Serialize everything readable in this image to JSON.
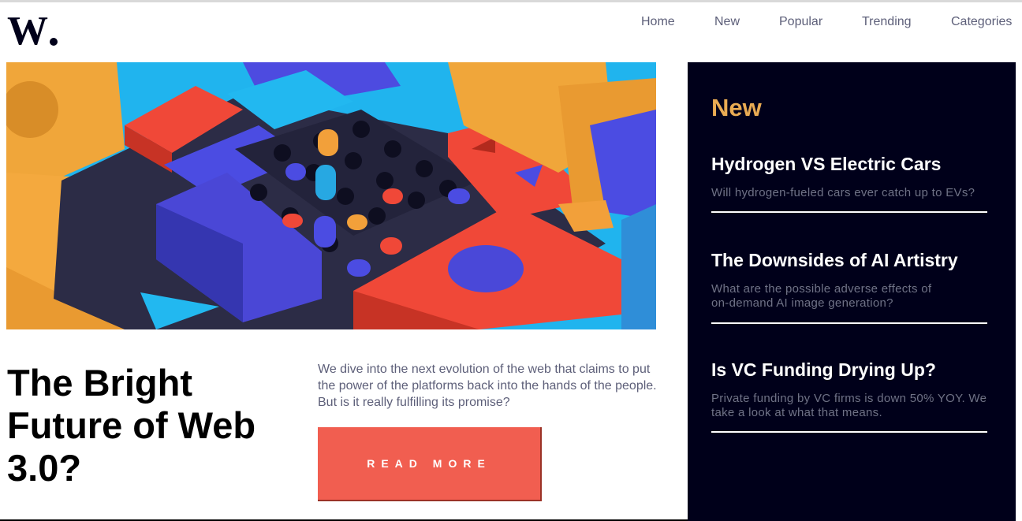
{
  "brand": {
    "logo_text": "W."
  },
  "nav": {
    "items": [
      {
        "label": "Home"
      },
      {
        "label": "New"
      },
      {
        "label": "Popular"
      },
      {
        "label": "Trending"
      },
      {
        "label": "Categories"
      }
    ]
  },
  "hero": {
    "title": "The Bright Future of Web 3.0?",
    "description": "We dive into the next evolution of the web that claims to put the power of the platforms back into the hands of the people. But is it really fulfilling its promise?",
    "cta_label": "READ MORE"
  },
  "sidebar": {
    "heading": "New",
    "articles": [
      {
        "title": "Hydrogen VS Electric Cars",
        "summary": "Will hydrogen-fueled cars ever catch up to EVs?"
      },
      {
        "title": "The Downsides of AI Artistry",
        "summary": "What are the possible adverse effects of on-demand AI image generation?"
      },
      {
        "title": "Is VC Funding Drying Up?",
        "summary": "Private funding by VC firms is down 50% YOY. We take a look at what that means."
      }
    ]
  },
  "colors": {
    "accent": "#f15e50",
    "sidebar_bg": "#00001a",
    "sidebar_heading": "#e9ab53",
    "nav_text": "#5d5f79"
  }
}
